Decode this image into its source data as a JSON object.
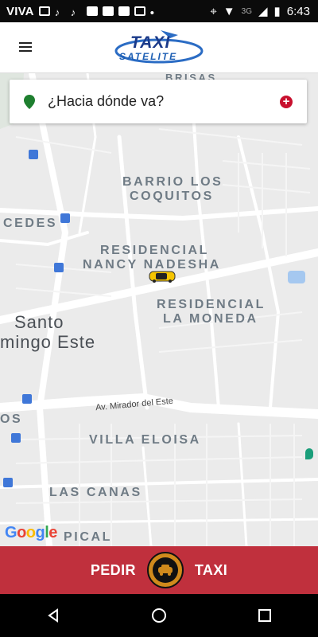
{
  "status_bar": {
    "carrier": "VIVA",
    "network": "3G",
    "time": "6:43"
  },
  "app": {
    "logo_line1": "TAXI",
    "logo_line2": "SATELITE"
  },
  "search": {
    "placeholder": "¿Hacia dónde va?",
    "add_icon": "plus-circle-icon"
  },
  "map": {
    "labels": {
      "top_left": "BRISAS",
      "barrio1": "BARRIO LOS",
      "barrio2": "COQUITOS",
      "cedes": "CEDES",
      "residencial1": "RESIDENCIAL",
      "residencial2": "NANCY NADESHA",
      "moneda1": "RESIDENCIAL",
      "moneda2": "LA MONEDA",
      "santo1": "Santo",
      "santo2": "mingo Este",
      "road": "Av. Mirador del Este",
      "os": "OS",
      "villa": "VILLA ELOISA",
      "canas": "LAS CANAS",
      "pical": "PICAL"
    },
    "google": [
      "G",
      "o",
      "o",
      "g",
      "l",
      "e"
    ]
  },
  "cta": {
    "left": "PEDIR",
    "right": "TAXI"
  },
  "colors": {
    "cta": "#c0303d",
    "pin": "#1e7f2f",
    "accent_red": "#c8102e"
  }
}
